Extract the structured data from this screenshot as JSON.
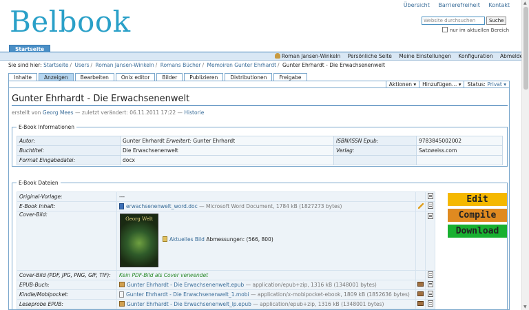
{
  "site": {
    "logo": "Belbook",
    "toplinks": [
      "Übersicht",
      "Barrierefreiheit",
      "Kontakt"
    ],
    "search_placeholder": "Website durchsuchen",
    "search_button": "Suche",
    "search_scope": "nur im aktuellen Bereich"
  },
  "tabs": {
    "main": "Startseite"
  },
  "personal": [
    "Roman Jansen-Winkeln",
    "Persönliche Seite",
    "Meine Einstellungen",
    "Konfiguration",
    "Abmelden"
  ],
  "breadcrumb": {
    "prefix": "Sie sind hier:",
    "items": [
      "Startseite",
      "Users",
      "Roman Jansen-Winkeln",
      "Romans Bücher",
      "Memoiren Gunter Ehrhardt",
      "Gunter Ehrhardt - Die Erwachsenenwelt"
    ],
    "separator": "/"
  },
  "content_tabs": [
    "Inhalte",
    "Anzeigen",
    "Bearbeiten",
    "Onix editor",
    "Bilder",
    "Publizieren",
    "Distributionen",
    "Freigabe"
  ],
  "actions": {
    "aktionen": "Aktionen ▾",
    "hinzufuegen": "Hinzufügen… ▾",
    "status_label": "Status:",
    "status_value": "Privat ▾"
  },
  "page": {
    "title": "Gunter Ehrhardt - Die Erwachsenenwelt",
    "byline_created": "erstellt von",
    "author_link": "Georg Mees",
    "byline_modified": "— zuletzt verändert: 06.11.2011 17:22 —",
    "history_link": "Historie"
  },
  "info": {
    "legend": "E-Book Informationen",
    "rows": [
      [
        "Autor:",
        "Gunter Ehrhardt",
        "Erweitert:",
        "Gunter Ehrhardt",
        "ISBN/ISSN Epub:",
        "9783845002002"
      ],
      [
        "Buchtitel:",
        "Die Erwachsenenwelt",
        "",
        "",
        "Verlag:",
        "Satzweiss.com"
      ],
      [
        "Format Eingabedatei:",
        "docx",
        "",
        "",
        "",
        ""
      ]
    ]
  },
  "files": {
    "legend": "E-Book Dateien",
    "original_label": "Original-Vorlage:",
    "original_value": "---",
    "inhalt_label": "E-Book Inhalt:",
    "inhalt_file": "erwachsenenwelt_word.doc",
    "inhalt_meta": "— Microsoft Word Document, 1784 kB (1827273 bytes)",
    "cover_label": "Cover-Bild:",
    "cover_image_text": "Georg Welt",
    "cover_link": "Aktuelles Bild",
    "cover_dims": "Abmessungen: (566, 800)",
    "coverpdf_label": "Cover-Bild (PDF, JPG, PNG, GIF, TIF):",
    "coverpdf_value": "Kein PDF-Bild als Cover verwendet",
    "epub_label": "EPUB-Buch:",
    "epub_file": "Gunter Ehrhardt - Die Erwachsenenwelt.epub",
    "epub_meta": "— application/epub+zip, 1316 kB (1348001 bytes)",
    "kindle_label": "Kindle/Mobipocket:",
    "kindle_file": "Gunter Ehrhardt - Die Erwachsenenwelt_1.mobi",
    "kindle_meta": "— application/x-mobipocket-ebook, 1809 kB (1852636 bytes)",
    "leseprobe_label": "Leseprobe EPUB:",
    "leseprobe_file": "Gunter Ehrhardt - Die Erwachsenenwelt_lp.epub",
    "leseprobe_meta": "— application/epub+zip, 1316 kB (1348001 bytes)"
  },
  "buttons": {
    "edit": "Edit",
    "compile": "Compile",
    "download": "Download"
  },
  "colors": {
    "logo": "#2aa0c8",
    "edit": "#f5b800",
    "compile": "#e08a20",
    "download": "#18b030"
  }
}
